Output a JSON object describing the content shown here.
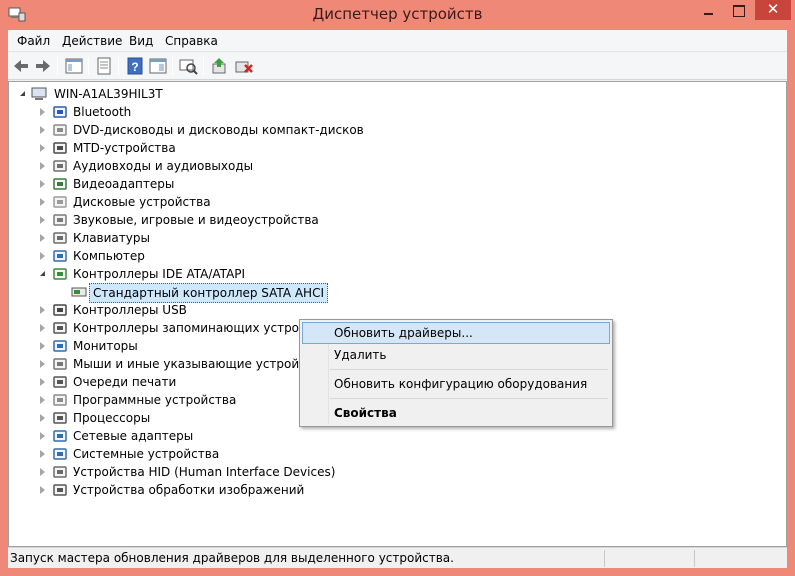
{
  "window": {
    "title": "Диспетчер устройств",
    "close_glyph": "✕"
  },
  "menu": {
    "items": [
      "Файл",
      "Действие",
      "Вид",
      "Справка"
    ]
  },
  "toolbar": {
    "icons": [
      "back-icon",
      "forward-icon",
      "show-hide-console-tree-icon",
      "properties-icon",
      "help-icon",
      "console-view-icon",
      "scan-hardware-icon",
      "update-driver-icon",
      "uninstall-icon"
    ]
  },
  "tree": {
    "root": "WIN-A1AL39HIL3T",
    "nodes": [
      {
        "label": "Bluetooth",
        "icon": "bluetooth-icon",
        "state": "collapsed"
      },
      {
        "label": "DVD-дисководы и дисководы компакт-дисков",
        "icon": "dvd-drive-icon",
        "state": "collapsed"
      },
      {
        "label": "MTD-устройства",
        "icon": "mtd-device-icon",
        "state": "collapsed"
      },
      {
        "label": "Аудиовходы и аудиовыходы",
        "icon": "speaker-icon",
        "state": "collapsed"
      },
      {
        "label": "Видеоадаптеры",
        "icon": "display-adapter-icon",
        "state": "collapsed"
      },
      {
        "label": "Дисковые устройства",
        "icon": "disk-drive-icon",
        "state": "collapsed"
      },
      {
        "label": "Звуковые, игровые и видеоустройства",
        "icon": "sound-icon",
        "state": "collapsed"
      },
      {
        "label": "Клавиатуры",
        "icon": "keyboard-icon",
        "state": "collapsed"
      },
      {
        "label": "Компьютер",
        "icon": "computer-icon",
        "state": "collapsed"
      },
      {
        "label": "Контроллеры IDE ATA/ATAPI",
        "icon": "ide-controller-icon",
        "state": "expanded"
      },
      {
        "label": "Контроллеры USB",
        "icon": "usb-icon",
        "state": "collapsed"
      },
      {
        "label": "Контроллеры запоминающих устройств",
        "icon": "storage-controller-icon",
        "state": "collapsed"
      },
      {
        "label": "Мониторы",
        "icon": "monitor-icon",
        "state": "collapsed"
      },
      {
        "label": "Мыши и иные указывающие устройства",
        "icon": "mouse-icon",
        "state": "collapsed"
      },
      {
        "label": "Очереди печати",
        "icon": "printer-icon",
        "state": "collapsed"
      },
      {
        "label": "Программные устройства",
        "icon": "software-device-icon",
        "state": "collapsed"
      },
      {
        "label": "Процессоры",
        "icon": "processor-icon",
        "state": "collapsed"
      },
      {
        "label": "Сетевые адаптеры",
        "icon": "network-adapter-icon",
        "state": "collapsed"
      },
      {
        "label": "Системные устройства",
        "icon": "system-device-icon",
        "state": "collapsed"
      },
      {
        "label": "Устройства HID (Human Interface Devices)",
        "icon": "hid-icon",
        "state": "collapsed"
      },
      {
        "label": "Устройства обработки изображений",
        "icon": "camera-icon",
        "state": "collapsed"
      }
    ],
    "child_selected": "Стандартный контроллер SATA AHCI"
  },
  "context_menu": {
    "update_drivers": "Обновить драйверы...",
    "delete": "Удалить",
    "scan_hardware": "Обновить конфигурацию оборудования",
    "properties": "Свойства"
  },
  "status": {
    "text": "Запуск мастера обновления драйверов для выделенного устройства."
  },
  "colors": {
    "frame": "#f08878",
    "close": "#c7453a",
    "selection": "#cde8ff",
    "menu_hover": "#d5e6f7"
  }
}
